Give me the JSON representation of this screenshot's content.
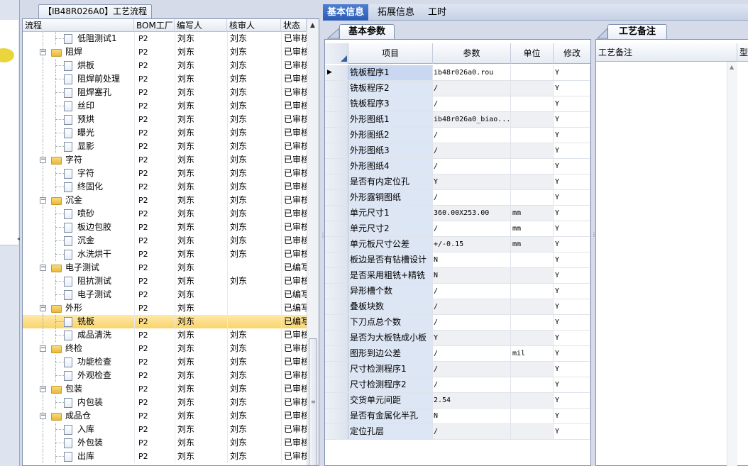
{
  "tree_tab": {
    "title": "【IB48R026A0】工艺流程"
  },
  "tree": {
    "columns": [
      "流程",
      "BOM工厂",
      "编写人",
      "核审人",
      "状态"
    ],
    "rows": [
      {
        "level": 2,
        "kind": "file",
        "name": "低阻测试1",
        "bom": "P2",
        "writer": "刘东",
        "reviewer": "刘东",
        "status": "已审核"
      },
      {
        "level": 1,
        "kind": "folder",
        "name": "阻焊",
        "bom": "P2",
        "writer": "刘东",
        "reviewer": "刘东",
        "status": "已审核"
      },
      {
        "level": 2,
        "kind": "file",
        "name": "烘板",
        "bom": "P2",
        "writer": "刘东",
        "reviewer": "刘东",
        "status": "已审核"
      },
      {
        "level": 2,
        "kind": "file",
        "name": "阻焊前处理",
        "bom": "P2",
        "writer": "刘东",
        "reviewer": "刘东",
        "status": "已审核"
      },
      {
        "level": 2,
        "kind": "file",
        "name": "阻焊塞孔",
        "bom": "P2",
        "writer": "刘东",
        "reviewer": "刘东",
        "status": "已审核"
      },
      {
        "level": 2,
        "kind": "file",
        "name": "丝印",
        "bom": "P2",
        "writer": "刘东",
        "reviewer": "刘东",
        "status": "已审核"
      },
      {
        "level": 2,
        "kind": "file",
        "name": "预烘",
        "bom": "P2",
        "writer": "刘东",
        "reviewer": "刘东",
        "status": "已审核"
      },
      {
        "level": 2,
        "kind": "file",
        "name": "曝光",
        "bom": "P2",
        "writer": "刘东",
        "reviewer": "刘东",
        "status": "已审核"
      },
      {
        "level": 2,
        "kind": "file",
        "name": "显影",
        "bom": "P2",
        "writer": "刘东",
        "reviewer": "刘东",
        "status": "已审核"
      },
      {
        "level": 1,
        "kind": "folder",
        "name": "字符",
        "bom": "P2",
        "writer": "刘东",
        "reviewer": "刘东",
        "status": "已审核"
      },
      {
        "level": 2,
        "kind": "file",
        "name": "字符",
        "bom": "P2",
        "writer": "刘东",
        "reviewer": "刘东",
        "status": "已审核"
      },
      {
        "level": 2,
        "kind": "file",
        "name": "终固化",
        "bom": "P2",
        "writer": "刘东",
        "reviewer": "刘东",
        "status": "已审核"
      },
      {
        "level": 1,
        "kind": "folder",
        "name": "沉金",
        "bom": "P2",
        "writer": "刘东",
        "reviewer": "刘东",
        "status": "已审核"
      },
      {
        "level": 2,
        "kind": "file",
        "name": "喷砂",
        "bom": "P2",
        "writer": "刘东",
        "reviewer": "刘东",
        "status": "已审核"
      },
      {
        "level": 2,
        "kind": "file",
        "name": "板边包胶",
        "bom": "P2",
        "writer": "刘东",
        "reviewer": "刘东",
        "status": "已审核"
      },
      {
        "level": 2,
        "kind": "file",
        "name": "沉金",
        "bom": "P2",
        "writer": "刘东",
        "reviewer": "刘东",
        "status": "已审核"
      },
      {
        "level": 2,
        "kind": "file",
        "name": "水洗烘干",
        "bom": "P2",
        "writer": "刘东",
        "reviewer": "刘东",
        "status": "已审核"
      },
      {
        "level": 1,
        "kind": "folder",
        "name": "电子测试",
        "bom": "P2",
        "writer": "刘东",
        "reviewer": "",
        "status": "已编写"
      },
      {
        "level": 2,
        "kind": "file",
        "name": "阻抗测试",
        "bom": "P2",
        "writer": "刘东",
        "reviewer": "刘东",
        "status": "已审核"
      },
      {
        "level": 2,
        "kind": "file",
        "name": "电子测试",
        "bom": "P2",
        "writer": "刘东",
        "reviewer": "",
        "status": "已编写"
      },
      {
        "level": 1,
        "kind": "folder",
        "name": "外形",
        "bom": "P2",
        "writer": "刘东",
        "reviewer": "",
        "status": "已编写"
      },
      {
        "level": 2,
        "kind": "file",
        "name": "铣板",
        "bom": "P2",
        "writer": "刘东",
        "reviewer": "",
        "status": "已编写",
        "selected": true
      },
      {
        "level": 2,
        "kind": "file",
        "name": "成品清洗",
        "bom": "P2",
        "writer": "刘东",
        "reviewer": "刘东",
        "status": "已审核"
      },
      {
        "level": 1,
        "kind": "folder",
        "name": "终检",
        "bom": "P2",
        "writer": "刘东",
        "reviewer": "刘东",
        "status": "已审核"
      },
      {
        "level": 2,
        "kind": "file",
        "name": "功能检查",
        "bom": "P2",
        "writer": "刘东",
        "reviewer": "刘东",
        "status": "已审核"
      },
      {
        "level": 2,
        "kind": "file",
        "name": "外观检查",
        "bom": "P2",
        "writer": "刘东",
        "reviewer": "刘东",
        "status": "已审核"
      },
      {
        "level": 1,
        "kind": "folder",
        "name": "包装",
        "bom": "P2",
        "writer": "刘东",
        "reviewer": "刘东",
        "status": "已审核"
      },
      {
        "level": 2,
        "kind": "file",
        "name": "内包装",
        "bom": "P2",
        "writer": "刘东",
        "reviewer": "刘东",
        "status": "已审核"
      },
      {
        "level": 1,
        "kind": "folder",
        "name": "成品仓",
        "bom": "P2",
        "writer": "刘东",
        "reviewer": "刘东",
        "status": "已审核"
      },
      {
        "level": 2,
        "kind": "file",
        "name": "入库",
        "bom": "P2",
        "writer": "刘东",
        "reviewer": "刘东",
        "status": "已审核"
      },
      {
        "level": 2,
        "kind": "file",
        "name": "外包装",
        "bom": "P2",
        "writer": "刘东",
        "reviewer": "刘东",
        "status": "已审核"
      },
      {
        "level": 2,
        "kind": "file",
        "name": "出库",
        "bom": "P2",
        "writer": "刘东",
        "reviewer": "刘东",
        "status": "已审核"
      }
    ]
  },
  "top_tabs": [
    {
      "label": "基本信息",
      "active": true
    },
    {
      "label": "拓展信息",
      "active": false
    },
    {
      "label": "工时",
      "active": false
    }
  ],
  "basic_params": {
    "tab_label": "基本参数",
    "columns": {
      "item": "项目",
      "param": "参数",
      "unit": "单位",
      "modify": "修改"
    },
    "rows": [
      {
        "item": "铣板程序1",
        "param": "ib48r026a0.rou",
        "unit": "",
        "modify": "Y",
        "current": true
      },
      {
        "item": "铣板程序2",
        "param": "/",
        "unit": "",
        "modify": "Y"
      },
      {
        "item": "铣板程序3",
        "param": "/",
        "unit": "",
        "modify": "Y"
      },
      {
        "item": "外形图纸1",
        "param": "ib48r026a0_biao...",
        "unit": "",
        "modify": "Y"
      },
      {
        "item": "外形图纸2",
        "param": "/",
        "unit": "",
        "modify": "Y"
      },
      {
        "item": "外形图纸3",
        "param": "/",
        "unit": "",
        "modify": "Y"
      },
      {
        "item": "外形图纸4",
        "param": "/",
        "unit": "",
        "modify": "Y"
      },
      {
        "item": "是否有内定位孔",
        "param": "Y",
        "unit": "",
        "modify": "Y"
      },
      {
        "item": "外形露铜图纸",
        "param": "/",
        "unit": "",
        "modify": "Y"
      },
      {
        "item": "单元尺寸1",
        "param": "360.00X253.00",
        "unit": "mm",
        "modify": "Y"
      },
      {
        "item": "单元尺寸2",
        "param": "/",
        "unit": "mm",
        "modify": "Y"
      },
      {
        "item": "单元板尺寸公差",
        "param": "+/-0.15",
        "unit": "mm",
        "modify": "Y"
      },
      {
        "item": "板边是否有钻槽设计",
        "param": "N",
        "unit": "",
        "modify": "Y"
      },
      {
        "item": "是否采用粗铣+精铣",
        "param": "N",
        "unit": "",
        "modify": "Y"
      },
      {
        "item": "异形槽个数",
        "param": "/",
        "unit": "",
        "modify": "Y"
      },
      {
        "item": "叠板块数",
        "param": "/",
        "unit": "",
        "modify": "Y"
      },
      {
        "item": "下刀点总个数",
        "param": "/",
        "unit": "",
        "modify": "Y"
      },
      {
        "item": "是否为大板铣成小板",
        "param": "Y",
        "unit": "",
        "modify": "Y"
      },
      {
        "item": "图形到边公差",
        "param": "/",
        "unit": "mil",
        "modify": "Y"
      },
      {
        "item": "尺寸检测程序1",
        "param": "/",
        "unit": "",
        "modify": "Y"
      },
      {
        "item": "尺寸检测程序2",
        "param": "/",
        "unit": "",
        "modify": "Y"
      },
      {
        "item": "交货单元间距",
        "param": "2.54",
        "unit": "",
        "modify": "Y"
      },
      {
        "item": "是否有金属化半孔",
        "param": "N",
        "unit": "",
        "modify": "Y"
      },
      {
        "item": "定位孔层",
        "param": "/",
        "unit": "",
        "modify": "Y"
      }
    ]
  },
  "remarks": {
    "tab_label": "工艺备注",
    "columns": [
      "工艺备注",
      "型"
    ]
  },
  "colors": {
    "active_tab": "#2b5cb6",
    "selected_row": "#f9d46c",
    "name_cell": "#dde6f4"
  }
}
